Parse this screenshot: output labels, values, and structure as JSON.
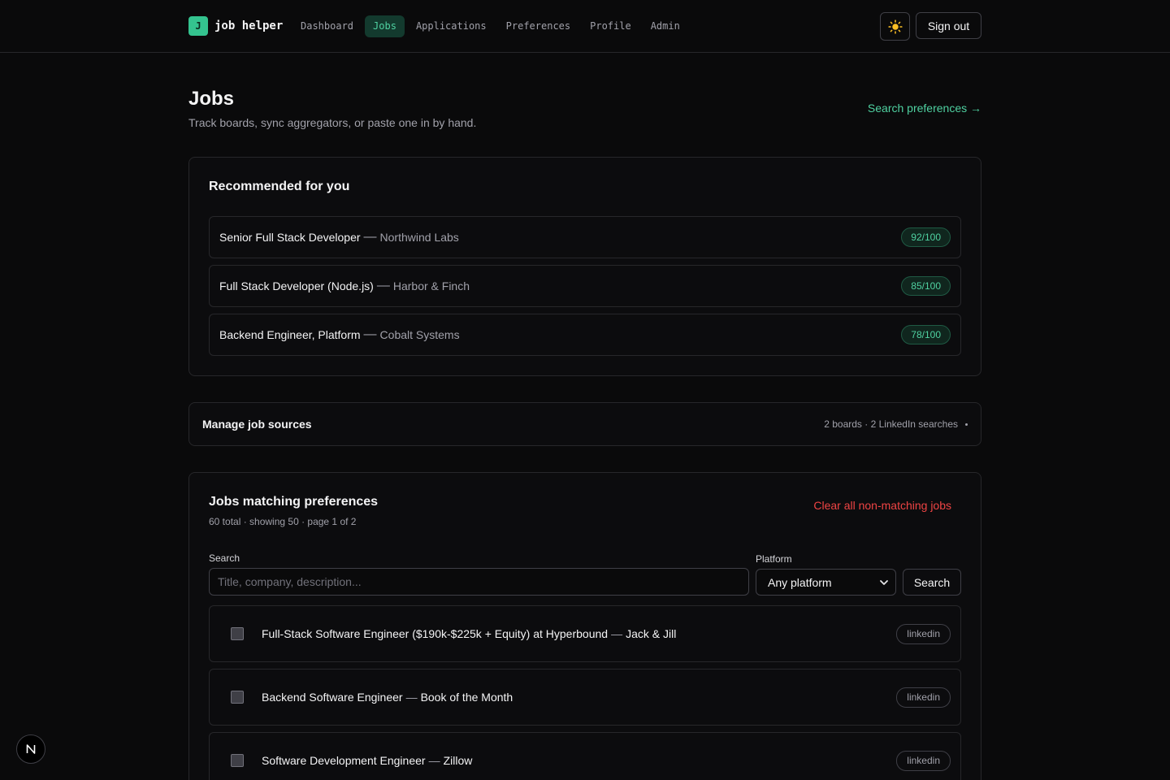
{
  "brand": {
    "mark": "J",
    "name": "job helper"
  },
  "nav": [
    {
      "label": "Dashboard",
      "active": false
    },
    {
      "label": "Jobs",
      "active": true
    },
    {
      "label": "Applications",
      "active": false
    },
    {
      "label": "Preferences",
      "active": false
    },
    {
      "label": "Profile",
      "active": false
    },
    {
      "label": "Admin",
      "active": false
    }
  ],
  "header": {
    "theme_icon": "sun-icon",
    "signout_label": "Sign out"
  },
  "page": {
    "title": "Jobs",
    "subtitle": "Track boards, sync aggregators, or paste one in by hand.",
    "prefs_link": "Search preferences →"
  },
  "recommended": {
    "title": "Recommended for you",
    "items": [
      {
        "title": "Senior Full Stack Developer",
        "company": "Northwind Labs",
        "score": "92/100"
      },
      {
        "title": "Full Stack Developer (Node.js)",
        "company": "Harbor & Finch",
        "score": "85/100"
      },
      {
        "title": "Backend Engineer, Platform",
        "company": "Cobalt Systems",
        "score": "78/100"
      }
    ]
  },
  "sources": {
    "title": "Manage job sources",
    "meta": "2 boards · 2 LinkedIn searches"
  },
  "jobs": {
    "title": "Jobs matching preferences",
    "summary": "60 total · showing 50 · page 1 of 2",
    "clear_label": "Clear all non-matching jobs",
    "search_label": "Search",
    "search_placeholder": "Title, company, description...",
    "platform_label": "Platform",
    "platform_value": "Any platform",
    "search_button": "Search",
    "items": [
      {
        "title": "Full-Stack Software Engineer ($190k-$225k + Equity) at Hyperbound",
        "company": "Jack & Jill",
        "platform": "linkedin"
      },
      {
        "title": "Backend Software Engineer",
        "company": "Book of the Month",
        "platform": "linkedin"
      },
      {
        "title": "Software Development Engineer",
        "company": "Zillow",
        "platform": "linkedin"
      }
    ]
  },
  "dash": "—",
  "colors": {
    "accent": "#34c38f",
    "accent_text": "#4fd1a1",
    "danger": "#ef4444",
    "background": "#0a0a0b"
  }
}
